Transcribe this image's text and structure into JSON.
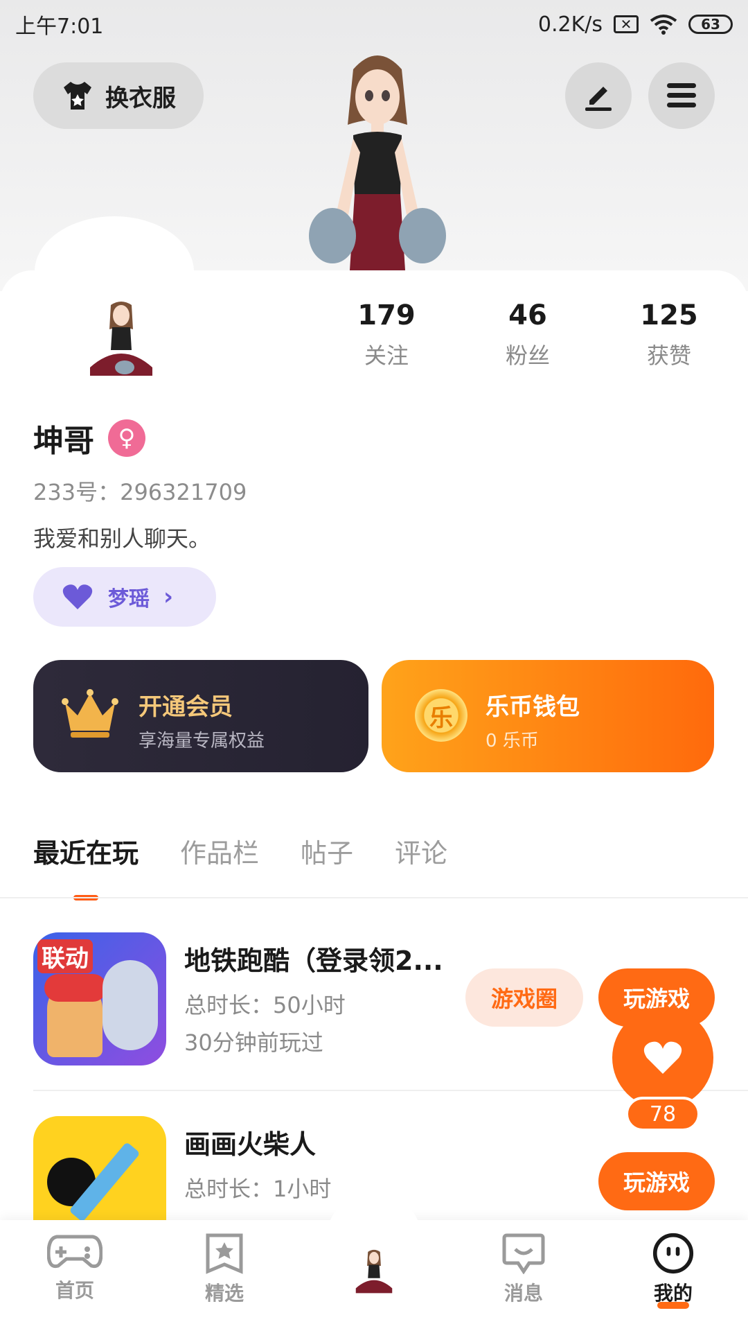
{
  "status": {
    "time": "上午7:01",
    "speed": "0.2K/s",
    "sim_icon": "sim-off-icon",
    "wifi_icon": "wifi-icon",
    "battery": "63"
  },
  "header": {
    "outfit_label": "换衣服",
    "edit_icon": "edit-icon",
    "menu_icon": "menu-icon"
  },
  "profile": {
    "stats": [
      {
        "value": "179",
        "label": "关注"
      },
      {
        "value": "46",
        "label": "粉丝"
      },
      {
        "value": "125",
        "label": "获赞"
      }
    ],
    "name": "坤哥",
    "gender_icon": "female-icon",
    "uid": "233号：296321709",
    "bio": "我爱和别人聊天。",
    "partner": "梦瑶"
  },
  "cards": {
    "vip_title": "开通会员",
    "vip_sub": "享海量专属权益",
    "wallet_title": "乐币钱包",
    "wallet_sub": "0 乐币",
    "coin_glyph": "乐"
  },
  "tabs": [
    "最近在玩",
    "作品栏",
    "帖子",
    "评论"
  ],
  "games": [
    {
      "title": "地铁跑酷（登录领2...",
      "duration": "总时长：50小时",
      "last_played": "30分钟前玩过",
      "circle_label": "游戏圈",
      "play_label": "玩游戏",
      "icon_text": "联动"
    },
    {
      "title": "画画火柴人",
      "duration": "总时长：1小时",
      "play_label": "玩游戏"
    }
  ],
  "like_count": "78",
  "nav": [
    "首页",
    "精选",
    "消息",
    "我的"
  ],
  "colors": {
    "accent": "#ff6a14",
    "gender": "#f06b96",
    "partner": "#6c5ad8"
  }
}
